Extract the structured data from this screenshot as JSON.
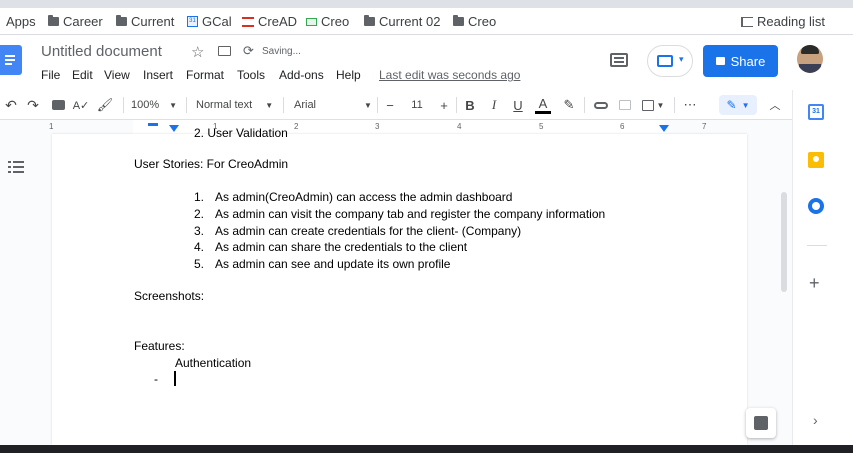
{
  "bookmarks": {
    "apps": "Apps",
    "items": [
      "Career",
      "Current",
      "GCal",
      "CreAD",
      "Creo",
      "Current 02",
      "Creo"
    ],
    "reading_list": "Reading list"
  },
  "header": {
    "title": "Untitled document",
    "saving": "Saving...",
    "menus": [
      "File",
      "Edit",
      "View",
      "Insert",
      "Format",
      "Tools",
      "Add-ons",
      "Help"
    ],
    "last_edit": "Last edit was seconds ago",
    "share": "Share"
  },
  "toolbar": {
    "zoom": "100%",
    "style": "Normal text",
    "font": "Arial",
    "font_size": "11",
    "minus": "−",
    "plus": "+",
    "bold": "B",
    "italic": "I",
    "underline": "U",
    "text_color": "A",
    "more": "⋯"
  },
  "ruler": {
    "numbers": [
      "1",
      "1",
      "2",
      "3",
      "4",
      "5",
      "6",
      "7"
    ]
  },
  "document": {
    "cut_line": "2.  User Validation",
    "user_stories_heading": "User Stories: For CreoAdmin",
    "stories": [
      {
        "num": "1.",
        "text": "As admin(CreoAdmin) can access the admin dashboard"
      },
      {
        "num": "2.",
        "text": "As admin can visit the company tab and register the company information"
      },
      {
        "num": "3.",
        "text": "As admin can create credentials for the client- (Company)"
      },
      {
        "num": "4.",
        "text": "As admin can share the credentials to the client"
      },
      {
        "num": "5.",
        "text": "As admin can see and update its own profile"
      }
    ],
    "screenshots": "Screenshots:",
    "features": "Features:",
    "authentication": "Authentication",
    "bullet": "-"
  },
  "colors": {
    "docs_blue": "#4285f4",
    "share_blue": "#1a73e8",
    "keep_yellow": "#fbbc04",
    "tasks_blue": "#1a73e8"
  }
}
